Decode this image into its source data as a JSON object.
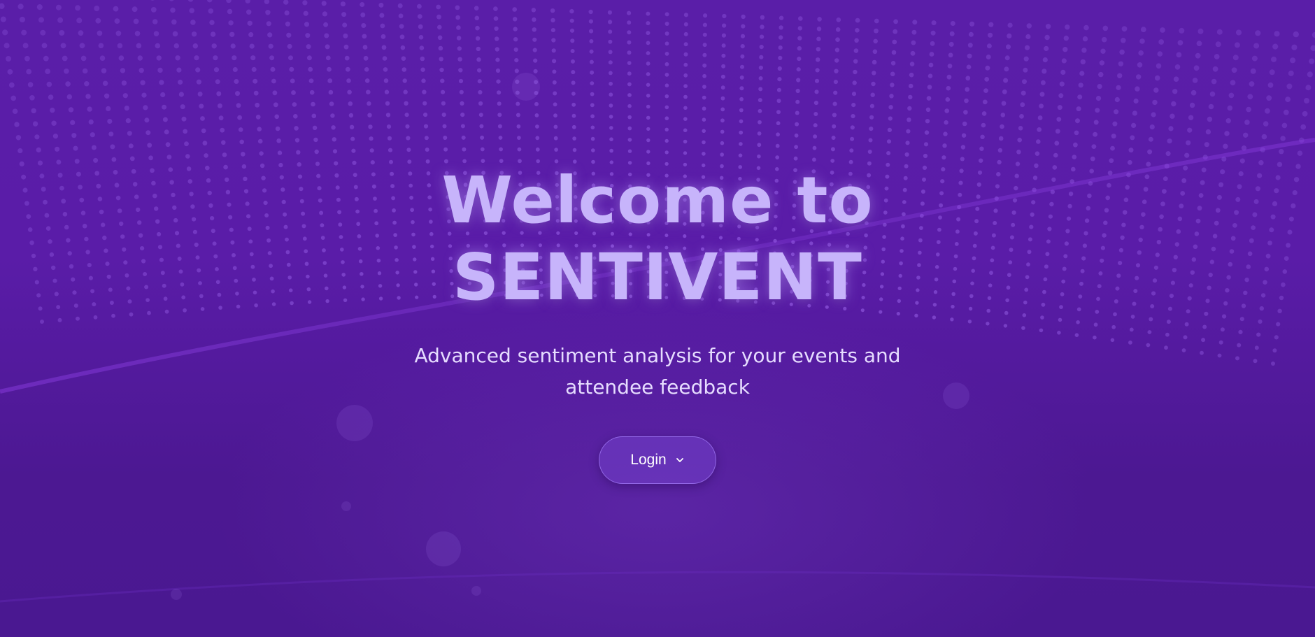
{
  "hero": {
    "title_line1": "Welcome to",
    "title_line2": "SENTIVENT",
    "subtitle": "Advanced sentiment analysis for your events and attendee feedback"
  },
  "login": {
    "label": "Login",
    "icon": "chevron-down-icon"
  },
  "colors": {
    "background": "#4a1791",
    "title": "#c7b4fb",
    "subtitle": "#e6dcff",
    "button_bg": "#6a3bc4"
  }
}
